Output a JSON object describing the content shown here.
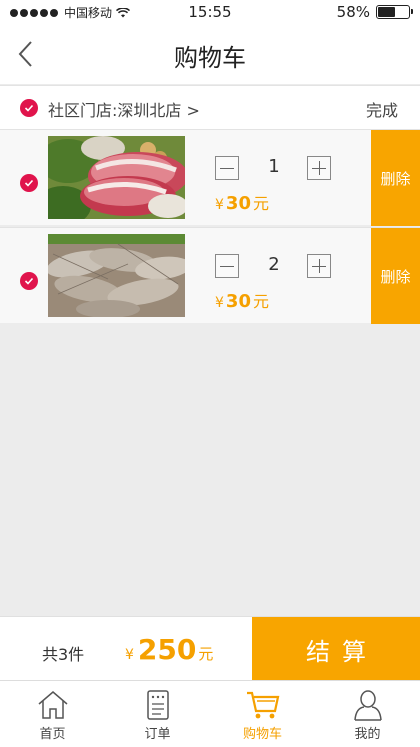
{
  "status_bar": {
    "carrier": "中国移动",
    "time": "15:55",
    "battery": "58%",
    "battery_level": 0.58
  },
  "nav": {
    "title": "购物车"
  },
  "store": {
    "name": "社区门店:深圳北店 >",
    "done_label": "完成"
  },
  "items": [
    {
      "quantity": "1",
      "price_symbol": "¥",
      "price": "30",
      "price_unit": "元",
      "delete_label": "删除",
      "image": "pork-photo"
    },
    {
      "quantity": "2",
      "price_symbol": "¥",
      "price": "30",
      "price_unit": "元",
      "delete_label": "删除",
      "image": "shrimp-photo"
    }
  ],
  "checkout": {
    "count_text": "共3件",
    "price_symbol": "¥",
    "total": "250",
    "unit": "元",
    "button_label": "结算"
  },
  "tabs": [
    {
      "label": "首页",
      "icon": "home-icon"
    },
    {
      "label": "订单",
      "icon": "order-icon"
    },
    {
      "label": "购物车",
      "icon": "cart-icon"
    },
    {
      "label": "我的",
      "icon": "user-icon"
    }
  ],
  "colors": {
    "accent": "#f8a500",
    "check": "#e0144c"
  }
}
